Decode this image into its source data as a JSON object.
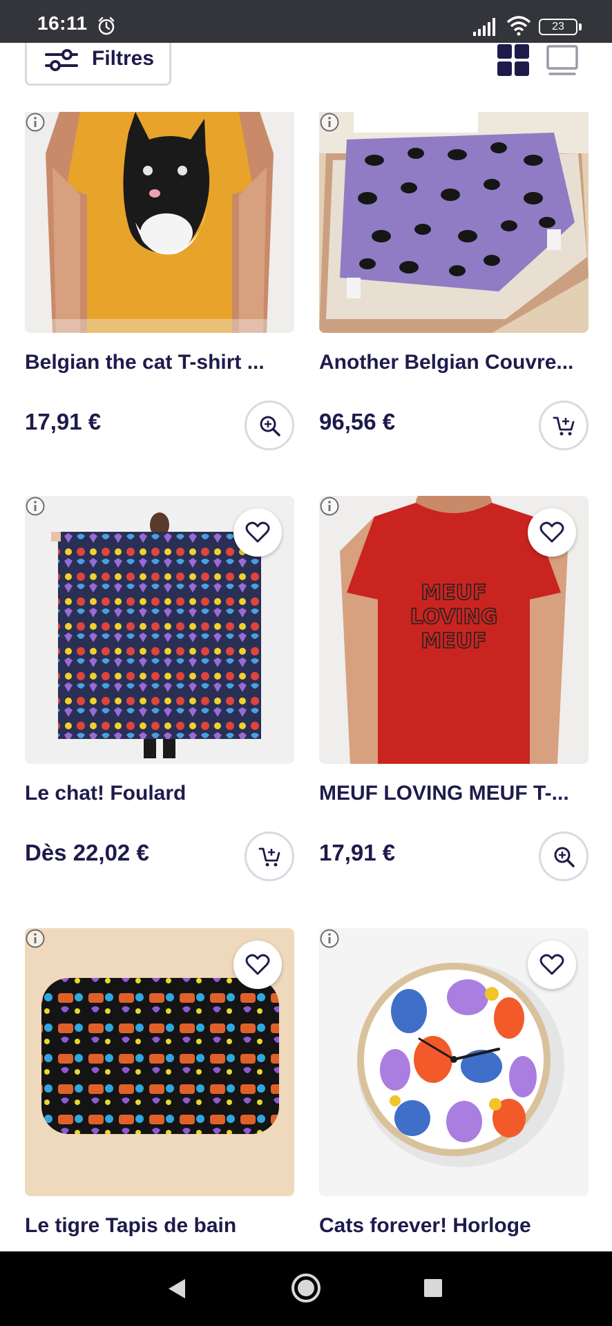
{
  "status_bar": {
    "time": "16:11",
    "battery": "23"
  },
  "toolbar": {
    "filter_label": "Filtres"
  },
  "products": [
    {
      "title": "Belgian the cat T-shirt ...",
      "price": "17,91 €",
      "action": "zoom"
    },
    {
      "title": "Another Belgian Couvre...",
      "price": "96,56 €",
      "action": "add-to-cart"
    },
    {
      "title": "Le chat! Foulard",
      "price": "Dès 22,02 €",
      "action": "add-to-cart"
    },
    {
      "title": "MEUF LOVING MEUF T-...",
      "price": "17,91 €",
      "action": "zoom"
    },
    {
      "title": "Le tigre Tapis de bain",
      "price": "",
      "action": ""
    },
    {
      "title": "Cats forever! Horloge",
      "price": "",
      "action": ""
    }
  ],
  "tshirt_print_text": [
    "MEUF",
    "LOVING",
    "MEUF"
  ],
  "colors": {
    "primary_text": "#1e1b4b",
    "status_bar": "#33353a",
    "tshirt_yellow": "#e8a42a",
    "tshirt_red": "#c9241f",
    "comforter_purple": "#8f7cc4"
  }
}
